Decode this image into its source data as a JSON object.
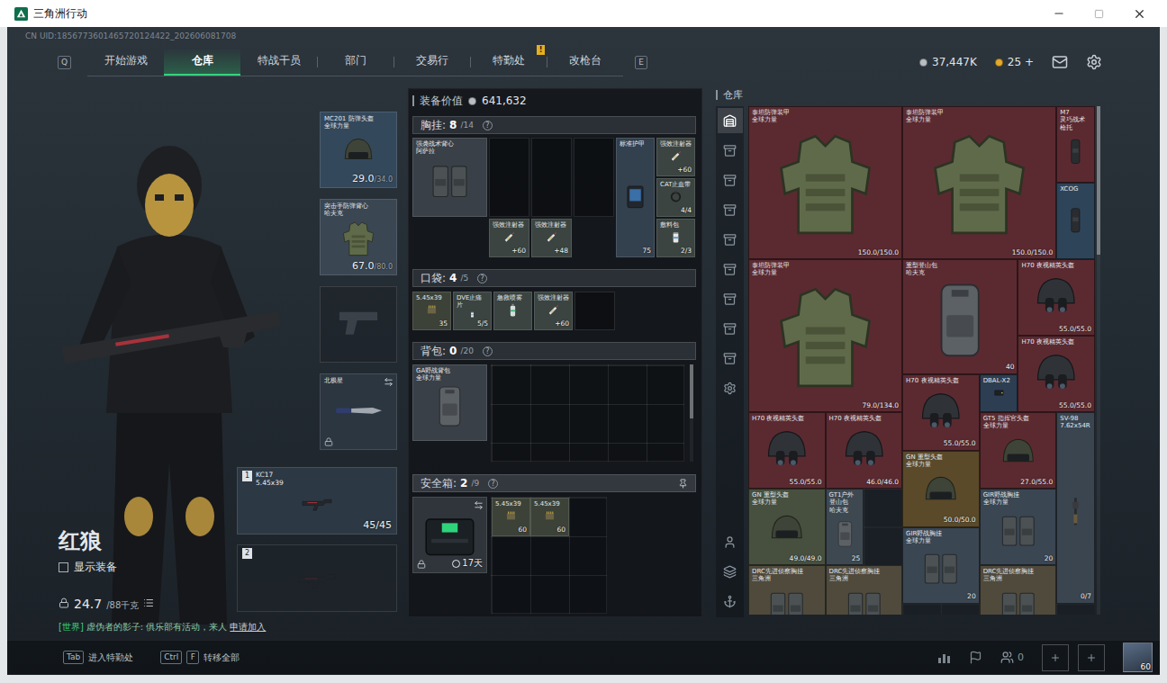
{
  "window": {
    "title": "三角洲行动"
  },
  "uid": "CN UID:1856773601465720124422_202606081708",
  "nav": {
    "prev_key": "Q",
    "next_key": "E",
    "tabs": [
      {
        "label": "开始游戏",
        "selected": false
      },
      {
        "label": "仓库",
        "selected": true
      },
      {
        "label": "特战干员",
        "selected": false
      },
      {
        "label": "部门",
        "selected": false
      },
      {
        "label": "交易行",
        "selected": false
      },
      {
        "label": "特勤处",
        "selected": false,
        "badge": "!"
      },
      {
        "label": "改枪台",
        "selected": false
      }
    ]
  },
  "currencies": [
    {
      "amount": "37,447K",
      "color": "#b9bec4"
    },
    {
      "amount": "25 +",
      "color": "#e3a92a"
    }
  ],
  "operator": {
    "name": "红狼",
    "show_equipment": {
      "label": "显示装备",
      "checked": false
    },
    "weight": "24.7",
    "weight_max": "/88千克"
  },
  "chat": {
    "channel": "[世界]",
    "message": "虚伪者的影子: 俱乐部有活动，来人",
    "action": "申请加入"
  },
  "equipment": [
    {
      "kind": "helmet",
      "name": "MC201 防弹头盔",
      "brand": "全球力量",
      "durability": "29.0",
      "max": "/34.0",
      "color": "#34485b",
      "empty": false,
      "locked": false
    },
    {
      "kind": "armor",
      "name": "突击手防弹背心",
      "brand": "哈夫克",
      "durability": "67.0",
      "max": "/80.0",
      "color": "#3a4652",
      "empty": false,
      "locked": false
    },
    {
      "kind": "pistol",
      "color": "#262d34",
      "empty": true,
      "locked": false
    },
    {
      "kind": "knife",
      "name": "北极星",
      "color": "#2c3640",
      "empty": false,
      "locked": true
    }
  ],
  "weapons": [
    {
      "slot": "1",
      "kind": "rifle",
      "name": "KC17",
      "caliber": "5.45x39",
      "ammo": "45/45",
      "empty": false
    },
    {
      "slot": "2",
      "kind": "rifle",
      "empty": true
    }
  ],
  "loadout": {
    "value_label": "装备价值",
    "value": "641,632",
    "chest_rig": {
      "label": "胸挂:",
      "count": "8",
      "capacity": "/14",
      "help": "?",
      "item": {
        "kind": "rig",
        "name": "强袭战术背心",
        "brand": "阿萨拉",
        "color": "#3a4047"
      },
      "slots": [
        {
          "kind": "empty"
        },
        {
          "kind": "empty"
        },
        {
          "kind": "empty"
        },
        {
          "kind": "syringe",
          "name": "强效注射器",
          "value": "+60",
          "color": "#3b4440"
        },
        {
          "kind": "syringe",
          "name": "强效注射器",
          "value": "+48",
          "color": "#3b4440"
        },
        {
          "kind": "plate",
          "name": "标准护甲",
          "value": "75",
          "color": "#33404d"
        },
        {
          "kind": "syringe",
          "name": "强效注射器",
          "value": "+60",
          "color": "#3b4440"
        },
        {
          "kind": "tourniquet",
          "name": "CAT止血带",
          "value": "4/4",
          "color": "#3b4440"
        },
        {
          "kind": "pills",
          "name": "敷料包",
          "value": "2/3",
          "color": "#3b4440"
        }
      ]
    },
    "pocket": {
      "label": "口袋:",
      "count": "4",
      "capacity": "/5",
      "help": "?",
      "slots": [
        {
          "kind": "ammo",
          "name": "5.45x39",
          "value": "35",
          "color": "#3d4238"
        },
        {
          "kind": "pills",
          "name": "DVE止痛片",
          "value": "5/5",
          "color": "#3b4440"
        },
        {
          "kind": "spray",
          "name": "急救喷雾",
          "color": "#3b4440"
        },
        {
          "kind": "syringe",
          "name": "强效注射器",
          "value": "+60",
          "color": "#3b4440"
        },
        {
          "kind": "empty"
        }
      ]
    },
    "backpack": {
      "label": "背包:",
      "count": "0",
      "capacity": "/20",
      "help": "?",
      "item": {
        "kind": "backpack",
        "name": "GA野战背包",
        "brand": "全球力量",
        "color": "#3a4047"
      }
    },
    "safe_box": {
      "label": "安全箱:",
      "count": "2",
      "capacity": "/9",
      "help": "?",
      "item": {
        "kind": "case",
        "time": "17天",
        "locked": true,
        "color": "#2f353b"
      },
      "slots": [
        {
          "kind": "ammo",
          "name": "5.45x39",
          "value": "60",
          "color": "#3d4238"
        },
        {
          "kind": "ammo",
          "name": "5.45x39",
          "value": "60",
          "color": "#3d4238"
        }
      ]
    }
  },
  "warehouse": {
    "title": "仓库",
    "sidebar": [
      {
        "kind": "home",
        "selected": true
      },
      {
        "kind": "storage",
        "selected": false
      },
      {
        "kind": "storage",
        "selected": false
      },
      {
        "kind": "storage",
        "selected": false
      },
      {
        "kind": "storage",
        "selected": false
      },
      {
        "kind": "storage",
        "selected": false
      },
      {
        "kind": "storage",
        "selected": false
      },
      {
        "kind": "storage",
        "selected": false
      },
      {
        "kind": "storage",
        "selected": false
      },
      {
        "kind": "settings",
        "selected": false
      }
    ],
    "sidebar_footer": [
      {
        "kind": "operator",
        "selected": false
      },
      {
        "kind": "layers",
        "selected": false
      },
      {
        "kind": "anchor",
        "selected": false
      }
    ],
    "items": [
      {
        "kind": "armor",
        "name": "泰坦防弹装甲",
        "brand": "全球力量",
        "value": "150.0/150.0",
        "color": "#5b2a31"
      },
      {
        "kind": "armor",
        "name": "泰坦防弹装甲",
        "brand": "全球力量",
        "value": "150.0/150.0",
        "color": "#5b2a31"
      },
      {
        "kind": "scope",
        "name": "M7",
        "brand": "灵巧战术枪托",
        "color": "#5b2a31"
      },
      {
        "kind": "scope",
        "name": "XCOG",
        "color": "#2e4458"
      },
      {
        "kind": "armor",
        "name": "泰坦防弹装甲",
        "brand": "全球力量",
        "value": "79.0/134.0",
        "color": "#5b2a31"
      },
      {
        "kind": "backpack",
        "name": "重型登山包",
        "brand": "哈夫克",
        "value": "40",
        "color": "#5b2a31"
      },
      {
        "kind": "nvg",
        "name": "H70 夜视精英头盔",
        "value": "55.0/55.0",
        "color": "#5b2a31"
      },
      {
        "kind": "nvg",
        "name": "H70 夜视精英头盔",
        "value": "55.0/55.0",
        "color": "#5b2a31"
      },
      {
        "kind": "nvg",
        "name": "H70 夜视精英头盔",
        "value": "55.0/55.0",
        "color": "#5b2a31"
      },
      {
        "kind": "laser",
        "name": "DBAL-X2",
        "color": "#2d3e52"
      },
      {
        "kind": "nvg",
        "name": "H70 夜视精英头盔",
        "value": "55.0/55.0",
        "color": "#5b2a31"
      },
      {
        "kind": "nvg",
        "name": "H70 夜视精英头盔",
        "value": "46.0/46.0",
        "color": "#5b2a31"
      },
      {
        "kind": "helmet",
        "name": "GT5 指挥官头盔",
        "brand": "全球力量",
        "value": "27.0/55.0",
        "color": "#5b2a31"
      },
      {
        "kind": "sniper",
        "name": "SV-98",
        "brand": "7.62x54R",
        "value": "0/7",
        "color": "#3a4550"
      },
      {
        "kind": "helmet",
        "name": "GN 重型头盔",
        "brand": "全球力量",
        "value": "50.0/50.0",
        "color": "#5a4a2a"
      },
      {
        "kind": "helmet",
        "name": "GN 重型头盔",
        "brand": "全球力量",
        "value": "49.0/49.0",
        "color": "#47503f"
      },
      {
        "kind": "backpack",
        "name": "GT1户外登山包",
        "brand": "哈夫克",
        "value": "25",
        "color": "#3e4850"
      },
      {
        "kind": "rig",
        "name": "GIR野战胸挂",
        "brand": "全球力量",
        "value": "20",
        "color": "#3a4652"
      },
      {
        "kind": "rig",
        "name": "GIR野战胸挂",
        "brand": "全球力量",
        "value": "20",
        "color": "#3a4652"
      },
      {
        "kind": "rig",
        "name": "DRC先进侦察胸挂",
        "brand": "三角洲",
        "color": "#4f4a3c"
      },
      {
        "kind": "rig",
        "name": "DRC先进侦察胸挂",
        "brand": "三角洲",
        "color": "#4f4a3c"
      },
      {
        "kind": "rig",
        "name": "DRC先进侦察胸挂",
        "brand": "三角洲",
        "color": "#4f4a3c"
      }
    ]
  },
  "bottom_bar": {
    "hints": [
      {
        "keys": [
          "Tab"
        ],
        "label": "进入特勤处"
      },
      {
        "keys": [
          "Ctrl",
          "F"
        ],
        "label": "转移全部"
      }
    ],
    "friends": "0",
    "level": "60"
  }
}
